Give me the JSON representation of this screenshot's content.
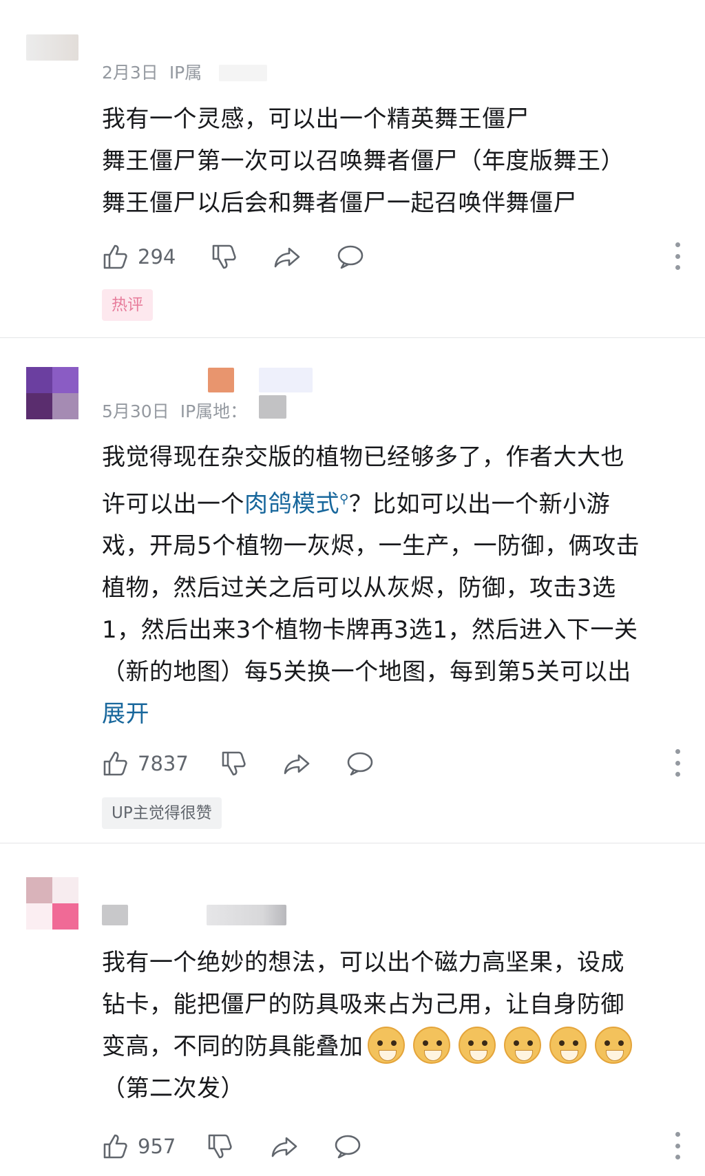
{
  "comments": [
    {
      "date": "2月3日",
      "ip_label": "IP属",
      "lines": [
        "我有一个灵感，可以出一个精英舞王僵尸",
        "舞王僵尸第一次可以召唤舞者僵尸（年度版舞王）",
        "舞王僵尸以后会和舞者僵尸一起召唤伴舞僵尸"
      ],
      "likes": "294",
      "tag": "热评"
    },
    {
      "date": "5月30日",
      "ip_label": "IP属地：",
      "line1": "我觉得现在杂交版的植物已经够多了，作者大大也",
      "line2_pre": "许可以出一个",
      "line2_link": "肉鸽模式",
      "line2_post": "？比如可以出一个新小游",
      "lines_rest": [
        "戏，开局5个植物一灰烬，一生产，一防御，俩攻击",
        "植物，然后过关之后可以从灰烬，防御，攻击3选",
        "1，然后出来3个植物卡牌再3选1，然后进入下一关",
        "（新的地图）每5关换一个地图，每到第5关可以出"
      ],
      "expand": "展开",
      "likes": "7837",
      "tag": "UP主觉得很赞"
    },
    {
      "lines": [
        "我有一个绝妙的想法，可以出个磁力高坚果，设成",
        "钻卡，能把僵尸的防具吸来占为己用，让自身防御"
      ],
      "line3": "变高，不同的防具能叠加",
      "line4": "（第二次发）",
      "emoji_count": 6,
      "likes": "957"
    }
  ],
  "icons": {
    "like": "thumbs-up-icon",
    "dislike": "thumbs-down-icon",
    "share": "share-icon",
    "reply": "reply-icon",
    "more": "more-icon",
    "emoji": "doge-emoji-icon",
    "search": "search-icon"
  },
  "colors": {
    "link": "#18679c",
    "meta": "#9499a0",
    "hot_tag_bg": "#fde8ee",
    "hot_tag_text": "#e77c9b",
    "up_tag_bg": "#f1f2f3"
  }
}
